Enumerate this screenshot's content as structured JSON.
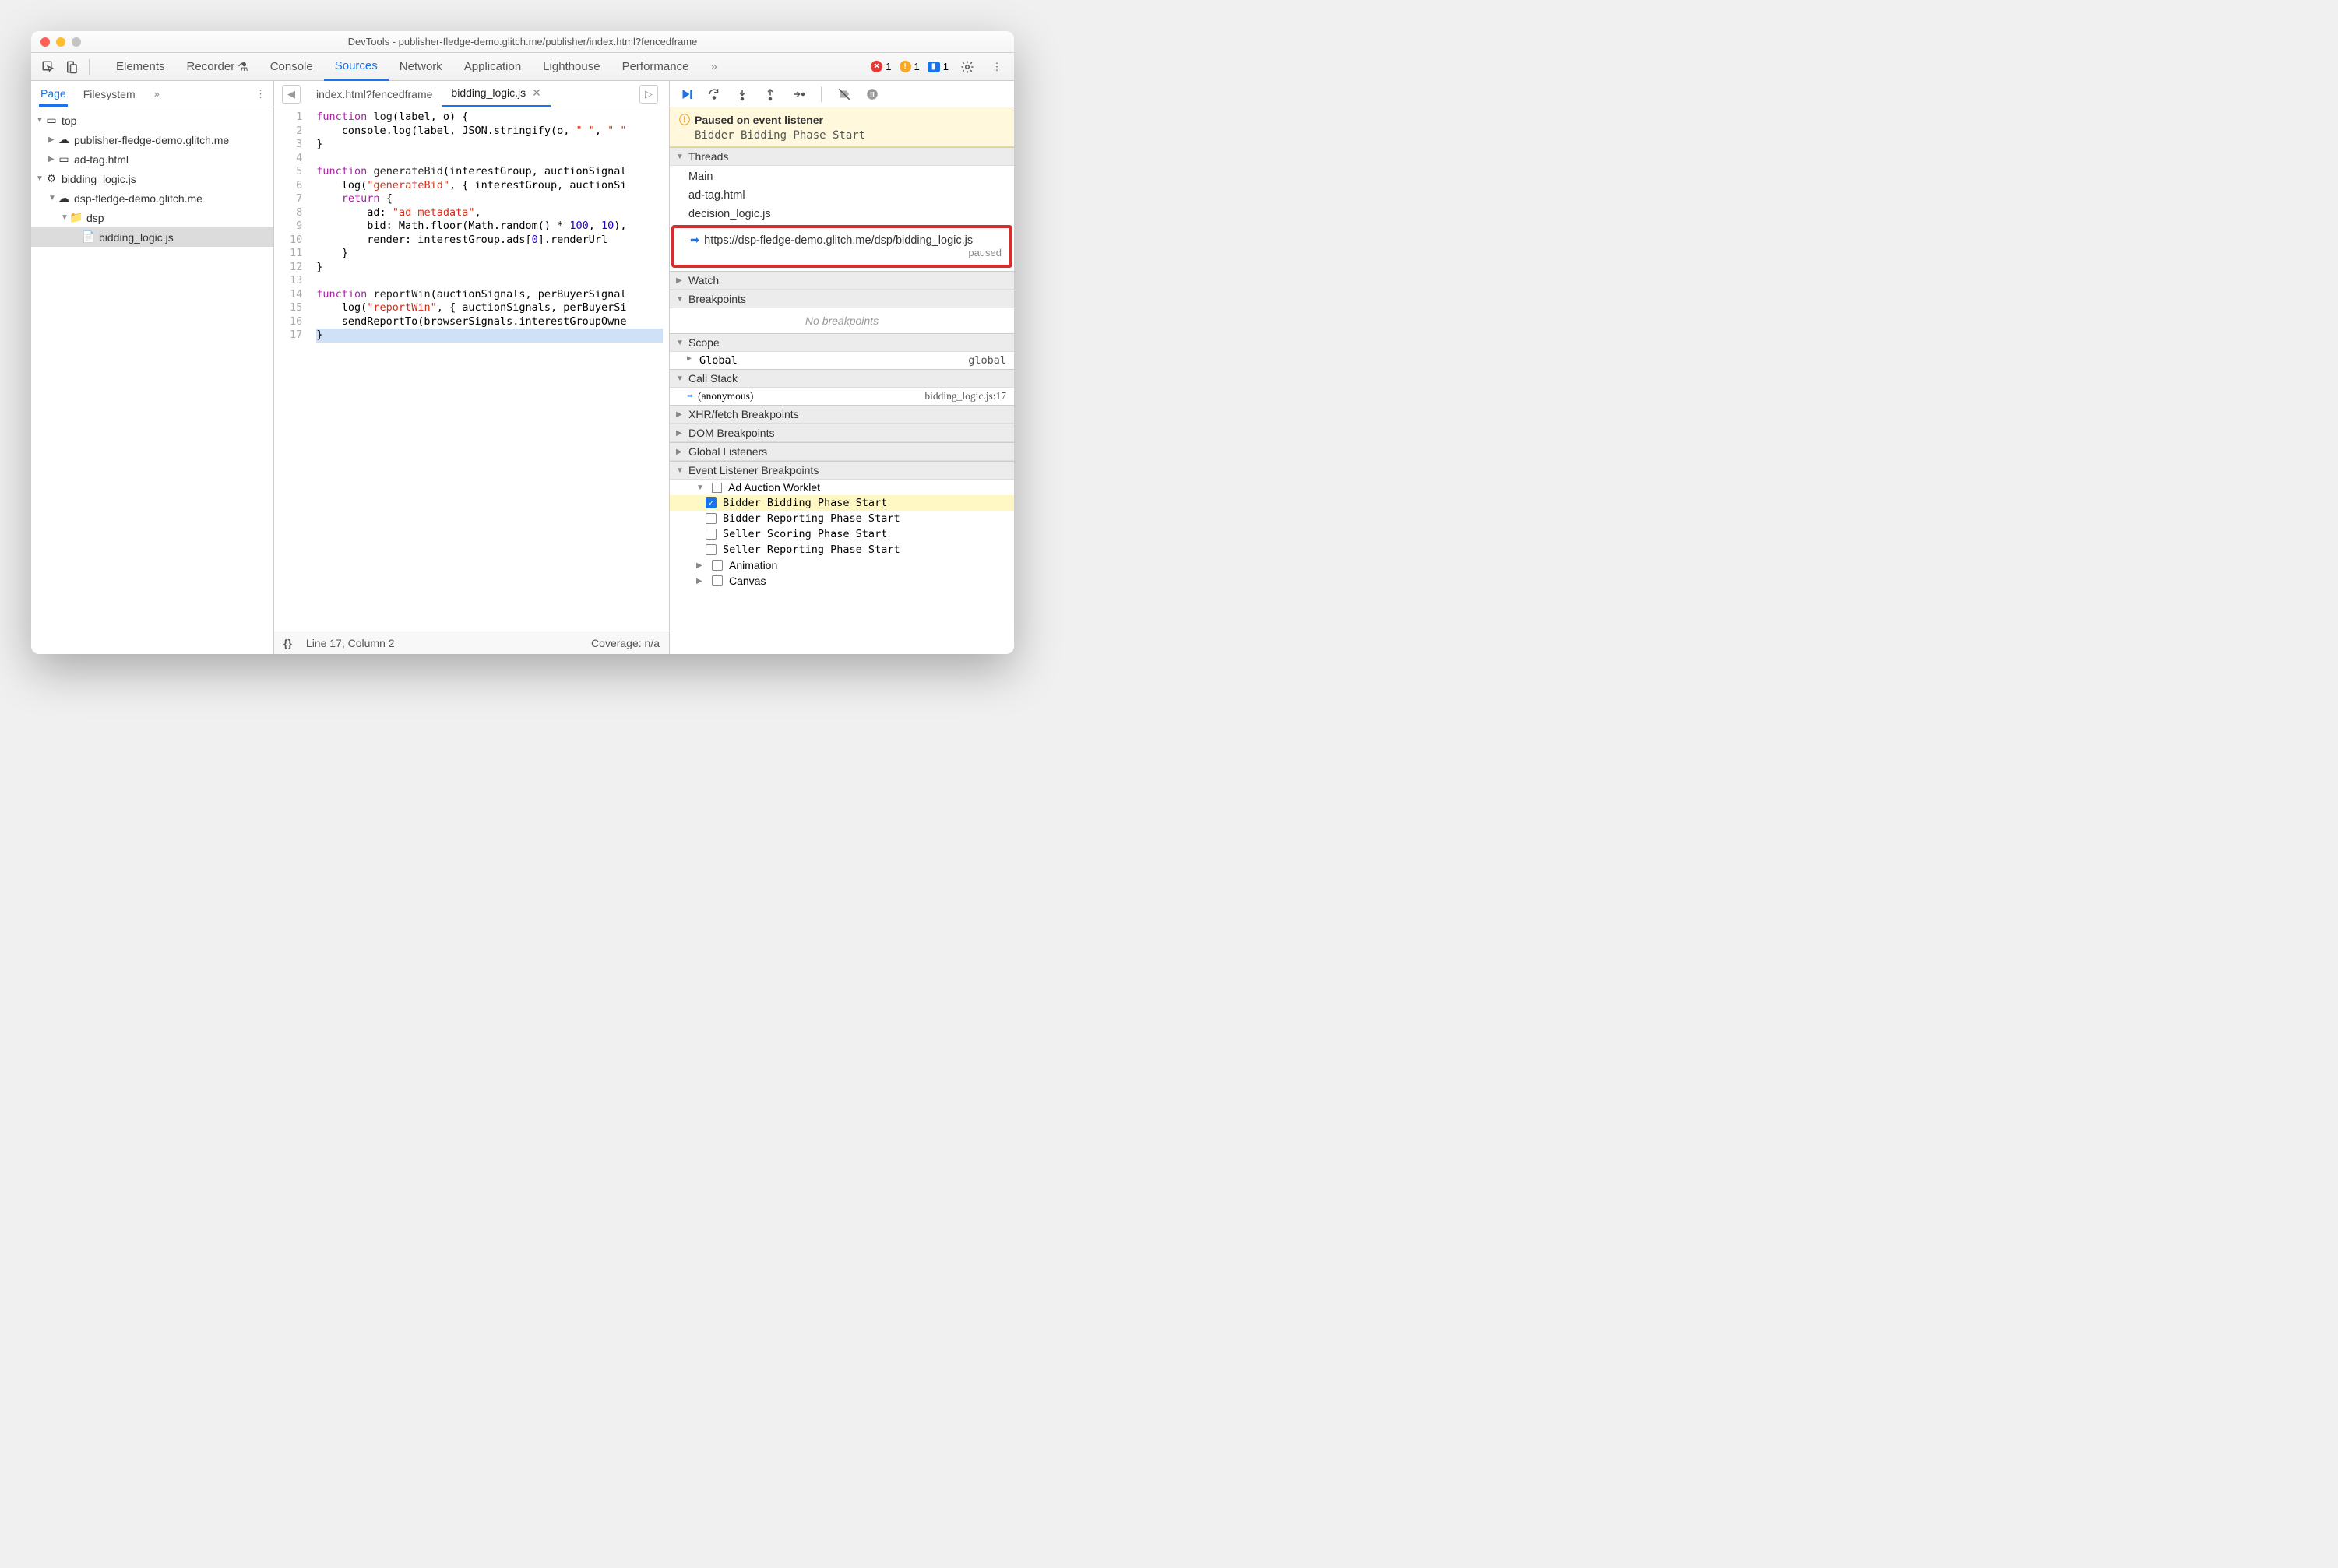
{
  "window": {
    "title": "DevTools - publisher-fledge-demo.glitch.me/publisher/index.html?fencedframe"
  },
  "toolbar": {
    "tabs": [
      "Elements",
      "Recorder",
      "Console",
      "Sources",
      "Network",
      "Application",
      "Lighthouse",
      "Performance"
    ],
    "active": "Sources",
    "errors": "1",
    "warnings": "1",
    "issues": "1"
  },
  "leftPane": {
    "tabs": [
      "Page",
      "Filesystem"
    ],
    "active": "Page",
    "tree": {
      "top": "top",
      "pub": "publisher-fledge-demo.glitch.me",
      "adtag": "ad-tag.html",
      "bidding1": "bidding_logic.js",
      "dsp_domain": "dsp-fledge-demo.glitch.me",
      "dsp_folder": "dsp",
      "bidding2": "bidding_logic.js"
    }
  },
  "fileTabs": {
    "t1": "index.html?fencedframe",
    "t2": "bidding_logic.js"
  },
  "code": {
    "lines": [
      "function log(label, o) {",
      "    console.log(label, JSON.stringify(o, \" \", \" \"",
      "}",
      "",
      "function generateBid(interestGroup, auctionSignal",
      "    log(\"generateBid\", { interestGroup, auctionSi",
      "    return {",
      "        ad: \"ad-metadata\",",
      "        bid: Math.floor(Math.random() * 100, 10),",
      "        render: interestGroup.ads[0].renderUrl",
      "    }",
      "}",
      "",
      "function reportWin(auctionSignals, perBuyerSignal",
      "    log(\"reportWin\", { auctionSignals, perBuyerSi",
      "    sendReportTo(browserSignals.interestGroupOwne",
      "}"
    ]
  },
  "statusbar": {
    "pos": "Line 17, Column 2",
    "coverage": "Coverage: n/a"
  },
  "paused": {
    "title": "Paused on event listener",
    "sub": "Bidder Bidding Phase Start"
  },
  "threads": {
    "header": "Threads",
    "items": [
      "Main",
      "ad-tag.html",
      "decision_logic.js"
    ],
    "highlighted": "https://dsp-fledge-demo.glitch.me/dsp/bidding_logic.js",
    "paused": "paused"
  },
  "sections": {
    "watch": "Watch",
    "breakpoints": "Breakpoints",
    "noBreakpoints": "No breakpoints",
    "scope": "Scope",
    "global": "Global",
    "globalVal": "global",
    "callstack": "Call Stack",
    "anon": "(anonymous)",
    "anonLoc": "bidding_logic.js:17",
    "xhr": "XHR/fetch Breakpoints",
    "dom": "DOM Breakpoints",
    "globalListeners": "Global Listeners",
    "eventListener": "Event Listener Breakpoints",
    "adAuction": "Ad Auction Worklet",
    "ev1": "Bidder Bidding Phase Start",
    "ev2": "Bidder Reporting Phase Start",
    "ev3": "Seller Scoring Phase Start",
    "ev4": "Seller Reporting Phase Start",
    "animation": "Animation",
    "canvas": "Canvas"
  }
}
